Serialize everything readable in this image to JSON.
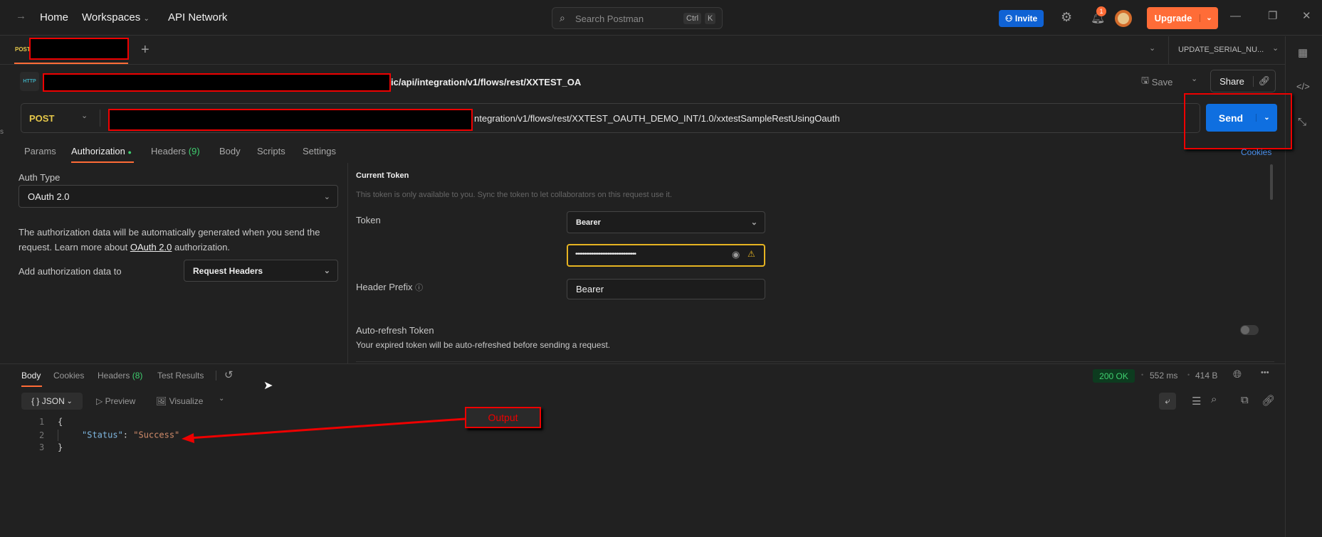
{
  "topbar": {
    "home": "Home",
    "workspaces": "Workspaces",
    "api_network": "API Network",
    "search_placeholder": "Search Postman",
    "shortcut_ctrl": "Ctrl",
    "shortcut_k": "K",
    "invite": "Invite",
    "notification_count": "1",
    "upgrade": "Upgrade"
  },
  "tabs": {
    "active_method": "POST",
    "environment": "UPDATE_SERIAL_NU..."
  },
  "request": {
    "title_suffix": "ic/api/integration/v1/flows/rest/XXTEST_OA",
    "method": "POST",
    "url_suffix": "ntegration/v1/flows/rest/XXTEST_OAUTH_DEMO_INT/1.0/xxtestSampleRestUsingOauth",
    "save": "Save",
    "share": "Share",
    "send": "Send",
    "cookies": "Cookies",
    "http_badge": "HTTP"
  },
  "req_tabs": [
    {
      "label": "Params"
    },
    {
      "label": "Authorization"
    },
    {
      "label": "Headers",
      "count": "(9)"
    },
    {
      "label": "Body"
    },
    {
      "label": "Scripts"
    },
    {
      "label": "Settings"
    }
  ],
  "auth": {
    "type_label": "Auth Type",
    "type_value": "OAuth 2.0",
    "desc_1": "The authorization data will be automatically generated when you send the",
    "desc_2a": "request. Learn more about ",
    "desc_link": "OAuth 2.0",
    "desc_2b": " authorization.",
    "add_to_label": "Add authorization data to",
    "add_to_value": "Request Headers"
  },
  "token": {
    "heading": "Current Token",
    "note": "This token is only available to you. Sync the token to let collaborators on this request use it.",
    "label": "Token",
    "type": "Bearer",
    "value_masked": "••••••••••••••••••••••••••••••••••",
    "prefix_label": "Header Prefix",
    "prefix_value": "Bearer",
    "refresh_label": "Auto-refresh Token",
    "refresh_desc": "Your expired token will be auto-refreshed before sending a request.",
    "refresh_enabled": false
  },
  "response": {
    "tabs": [
      {
        "label": "Body"
      },
      {
        "label": "Cookies"
      },
      {
        "label": "Headers",
        "count": "(8)"
      },
      {
        "label": "Test Results"
      }
    ],
    "status": "200 OK",
    "time": "552 ms",
    "size": "414 B",
    "format": "JSON",
    "preview": "Preview",
    "visualize": "Visualize",
    "lines": [
      {
        "n": "1",
        "text": "{"
      },
      {
        "n": "2",
        "key": "\"Status\"",
        "sep": ": ",
        "val": "\"Success\""
      },
      {
        "n": "3",
        "text": "}"
      }
    ]
  },
  "annotation": {
    "label": "Output"
  },
  "colors": {
    "accent": "#ff6c37",
    "send": "#0f6fe0",
    "invite": "#0f62d4",
    "ok": "#3fcf6f",
    "json_key": "#7fb7e0",
    "json_val": "#d08b6a"
  }
}
